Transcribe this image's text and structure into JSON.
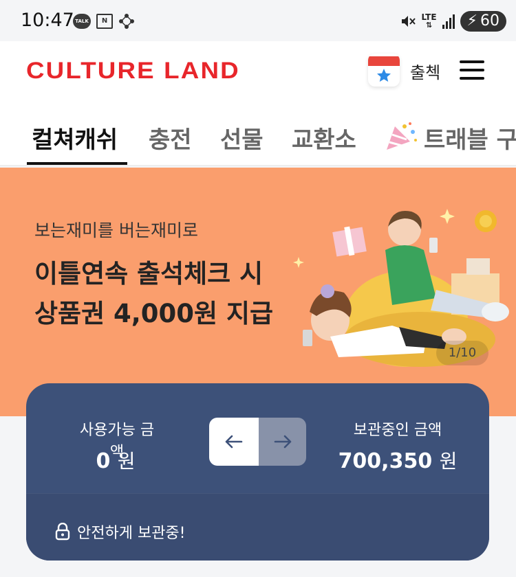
{
  "status_bar": {
    "time": "10:47",
    "talk_badge": "TALK",
    "mail_badge": "N",
    "network_type": "LTE",
    "battery": "60",
    "icons": [
      "kakaotalk-icon",
      "naver-mail-icon",
      "network-icon",
      "mute-icon",
      "signal-icon",
      "battery-charging-icon"
    ]
  },
  "header": {
    "logo": "CULTURE LAND",
    "attendance_label": "출첵",
    "icons": [
      "calendar-star-icon",
      "hamburger-menu-icon"
    ],
    "colors": {
      "logo": "#e8262b",
      "calendar_top": "#e8453c",
      "star": "#2e8be6"
    }
  },
  "tabs": [
    {
      "label": "컬쳐캐쉬",
      "active": true
    },
    {
      "label": "충전",
      "active": false
    },
    {
      "label": "선물",
      "active": false
    },
    {
      "label": "교환소",
      "active": false
    },
    {
      "label": "트래블 구",
      "active": false,
      "icon": "party-popper-icon"
    }
  ],
  "banner": {
    "subtitle": "보는재미를 버는재미로",
    "title_line1": "이틀연속 출석체크 시",
    "title_line2": "상품권 4,000원 지급",
    "counter": "1/10",
    "background": "#fa9e6d"
  },
  "balance_card": {
    "available_label": "사용가능 금액",
    "available_amount": "0",
    "stored_label": "보관중인 금액",
    "stored_amount": "700,350",
    "currency_unit": "원",
    "safe_text": "안전하게 보관중!",
    "icons": [
      "arrow-left-icon",
      "arrow-right-icon",
      "lock-icon"
    ],
    "background": "#3d5179"
  }
}
